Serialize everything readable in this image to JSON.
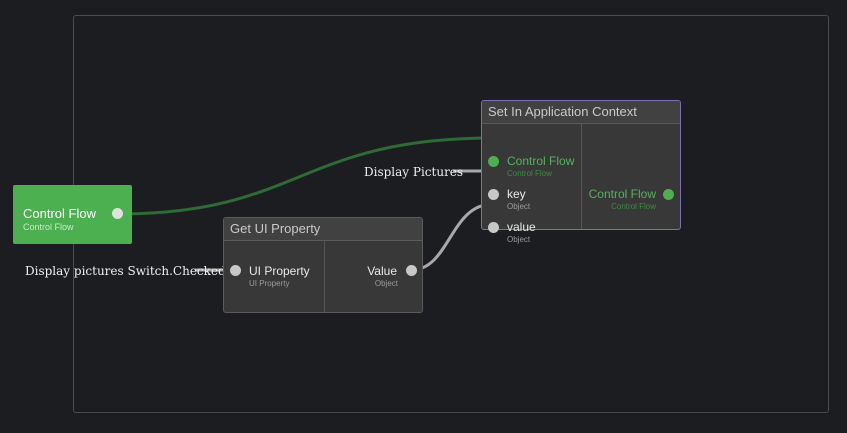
{
  "colors": {
    "background": "#1c1d20",
    "control_flow_green": "#4caf50",
    "wire_control": "#2e6b36",
    "wire_data": "#a8a8a8",
    "selected_border": "#7e6fb5"
  },
  "control_flow_node": {
    "label": "Control Flow",
    "sublabel": "Control Flow"
  },
  "get_ui_property": {
    "title": "Get UI Property",
    "inputs": [
      {
        "label": "UI Property",
        "type": "UI Property",
        "constant": "Display pictures Switch.Checked"
      }
    ],
    "outputs": [
      {
        "label": "Value",
        "type": "Object"
      }
    ]
  },
  "set_in_app_context": {
    "title": "Set In Application Context",
    "inputs": [
      {
        "label": "Control Flow",
        "type": "Control Flow"
      },
      {
        "label": "key",
        "type": "Object",
        "constant": "Display Pictures"
      },
      {
        "label": "value",
        "type": "Object"
      }
    ],
    "outputs": [
      {
        "label": "Control Flow",
        "type": "Control Flow"
      }
    ]
  }
}
